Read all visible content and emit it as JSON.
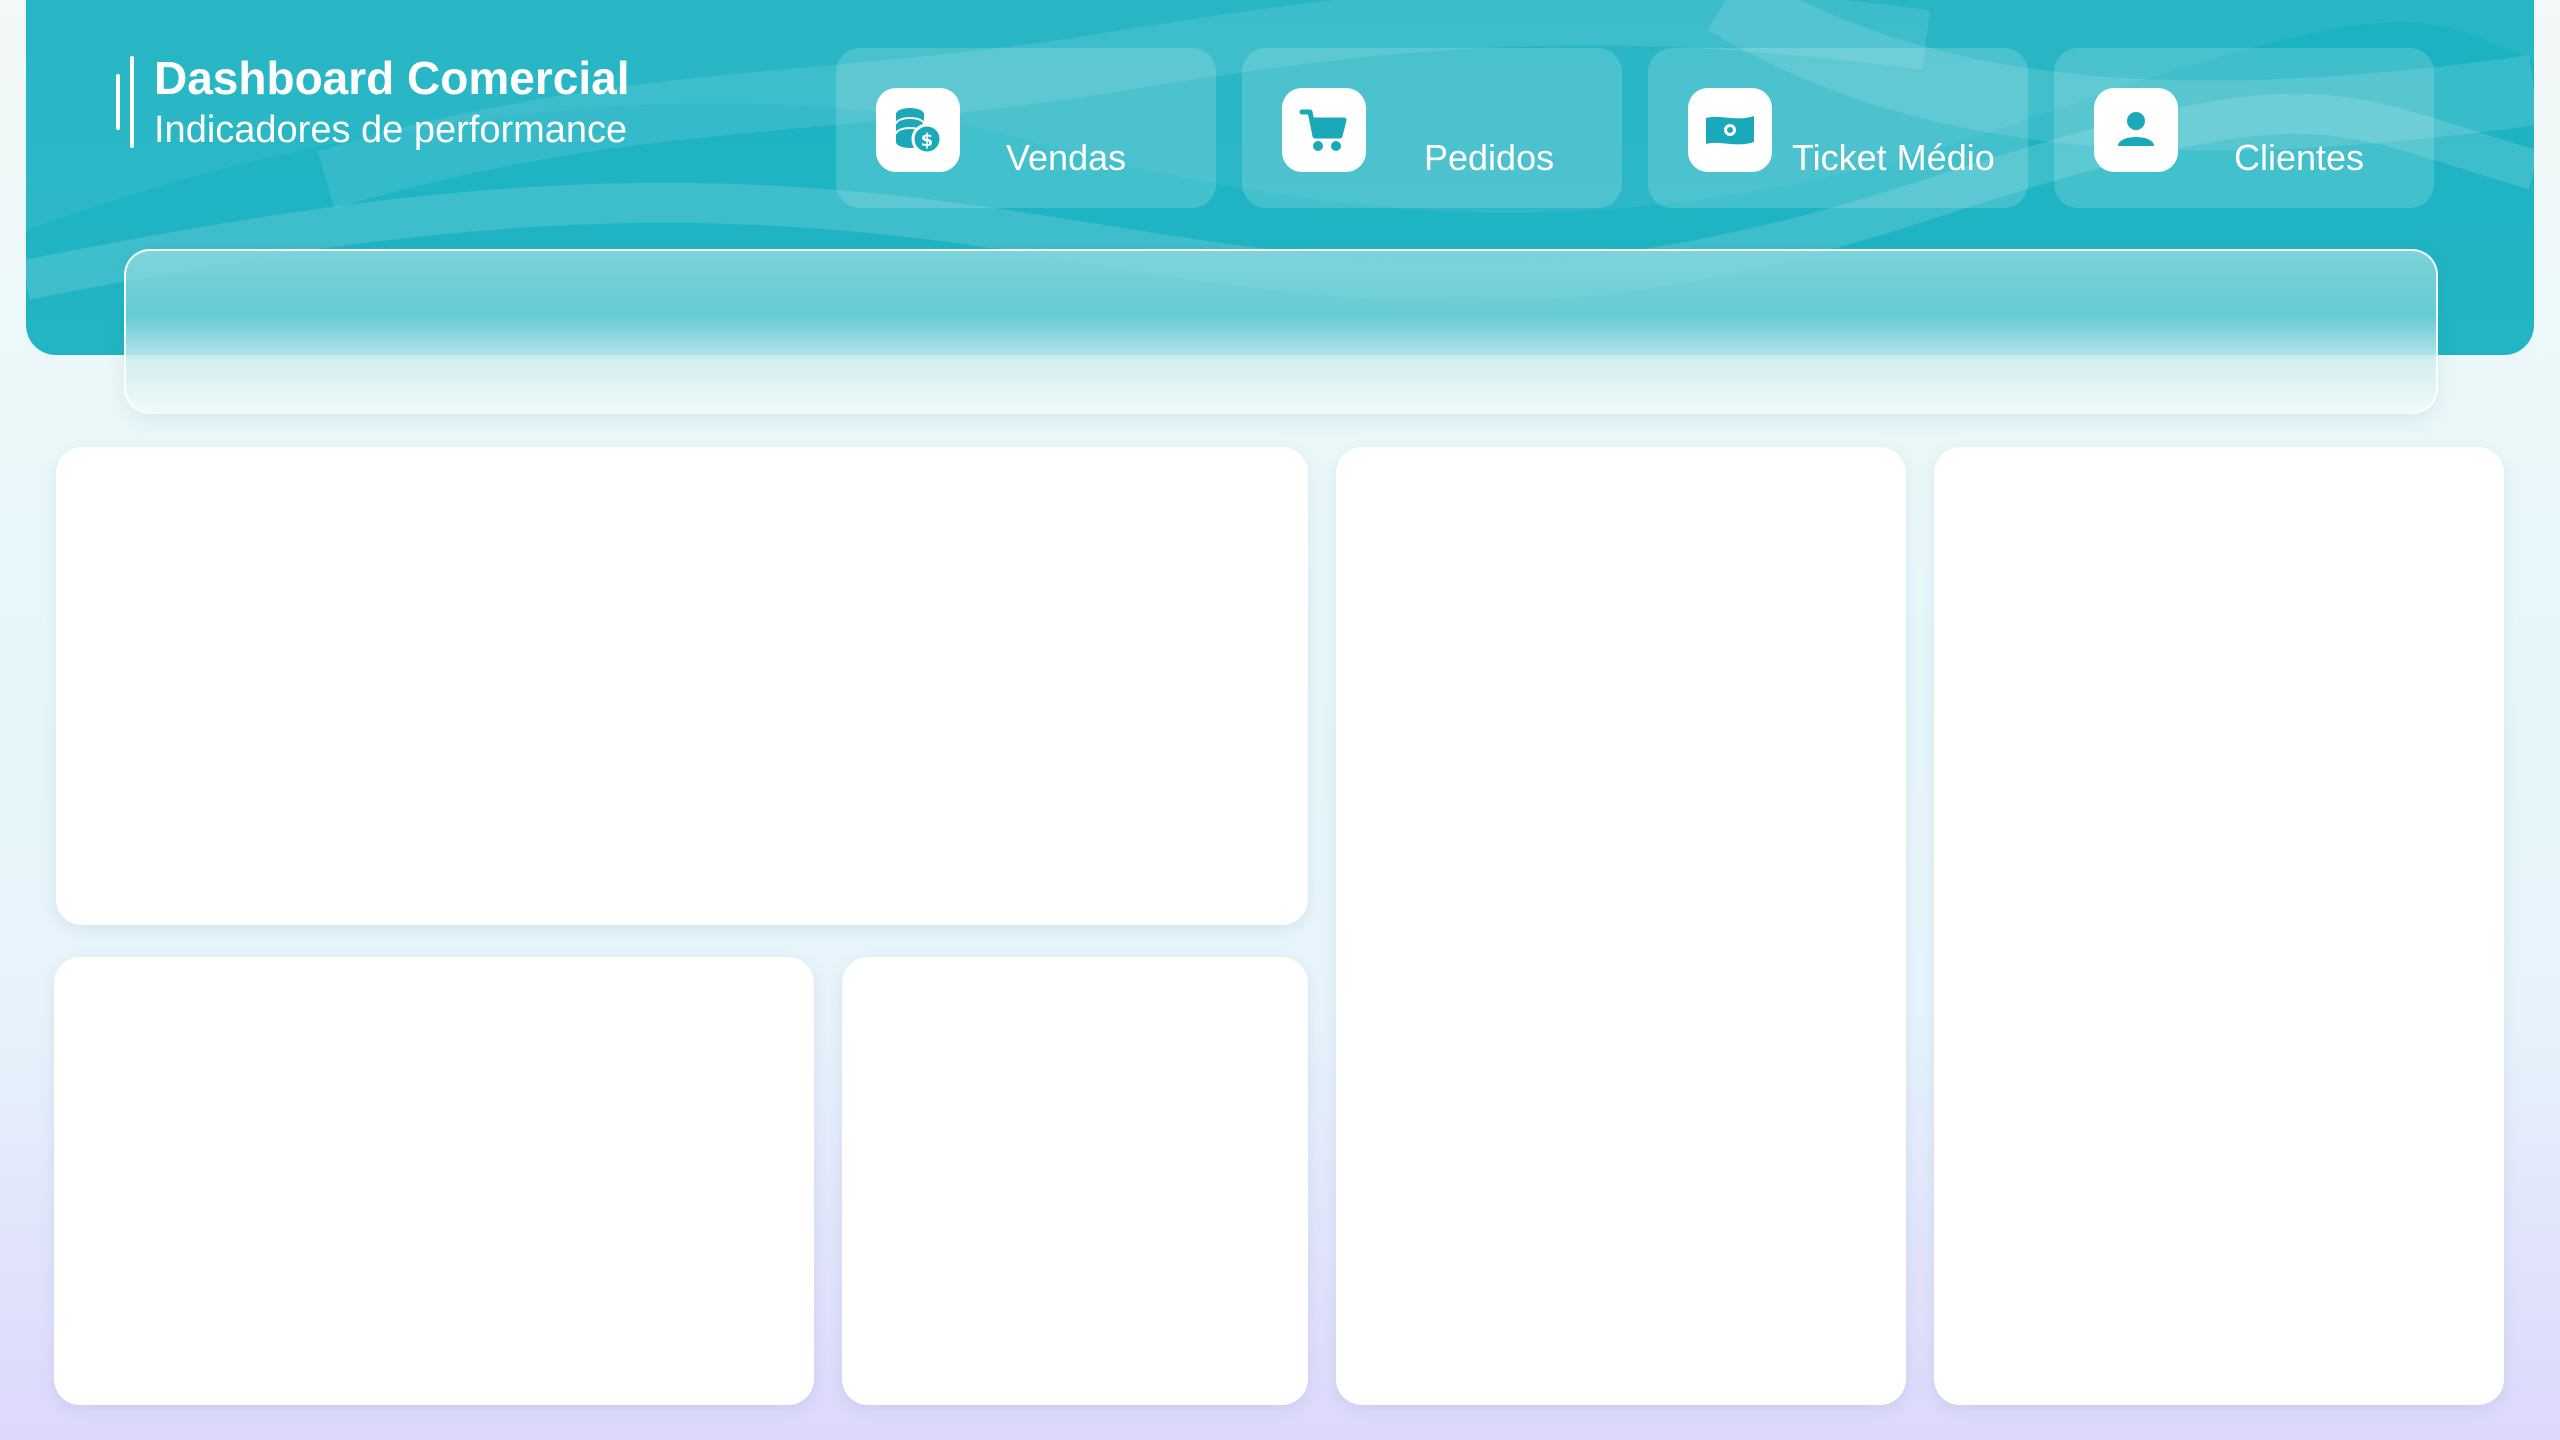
{
  "brand": {
    "title": "Dashboard Comercial",
    "subtitle": "Indicadores de performance"
  },
  "kpis": [
    {
      "label": "Vendas",
      "icon": "coins-dollar-icon"
    },
    {
      "label": "Pedidos",
      "icon": "shopping-cart-icon"
    },
    {
      "label": "Ticket Médio",
      "icon": "banknote-icon"
    },
    {
      "label": "Clientes",
      "icon": "user-icon"
    }
  ],
  "colors": {
    "accent": "#1ab2c1",
    "icon": "#1aa9b8",
    "panel": "#ffffff"
  }
}
